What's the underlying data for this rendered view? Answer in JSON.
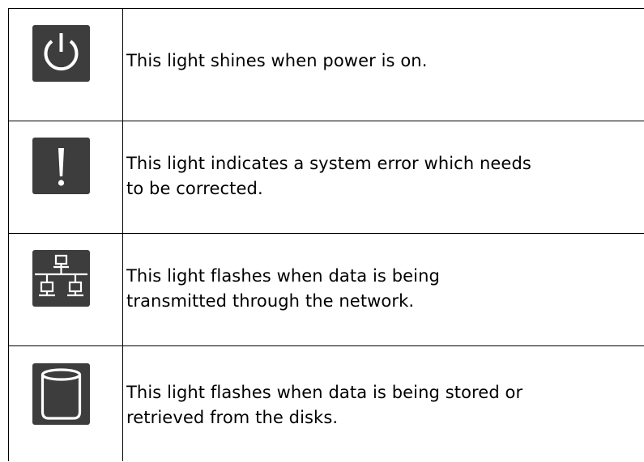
{
  "indicators": [
    {
      "icon": "power-icon",
      "description": "This light shines when power is on."
    },
    {
      "icon": "exclamation-icon",
      "description": "This light indicates a system error which needs\nto be corrected."
    },
    {
      "icon": "network-icon",
      "description": "This light flashes when data is being\ntransmitted through the network."
    },
    {
      "icon": "disk-icon",
      "description": "This light flashes when data is being stored or\nretrieved from the disks."
    }
  ],
  "colors": {
    "icon_background": "#3d3d3d",
    "icon_stroke": "#ffffff",
    "border": "#000000"
  }
}
